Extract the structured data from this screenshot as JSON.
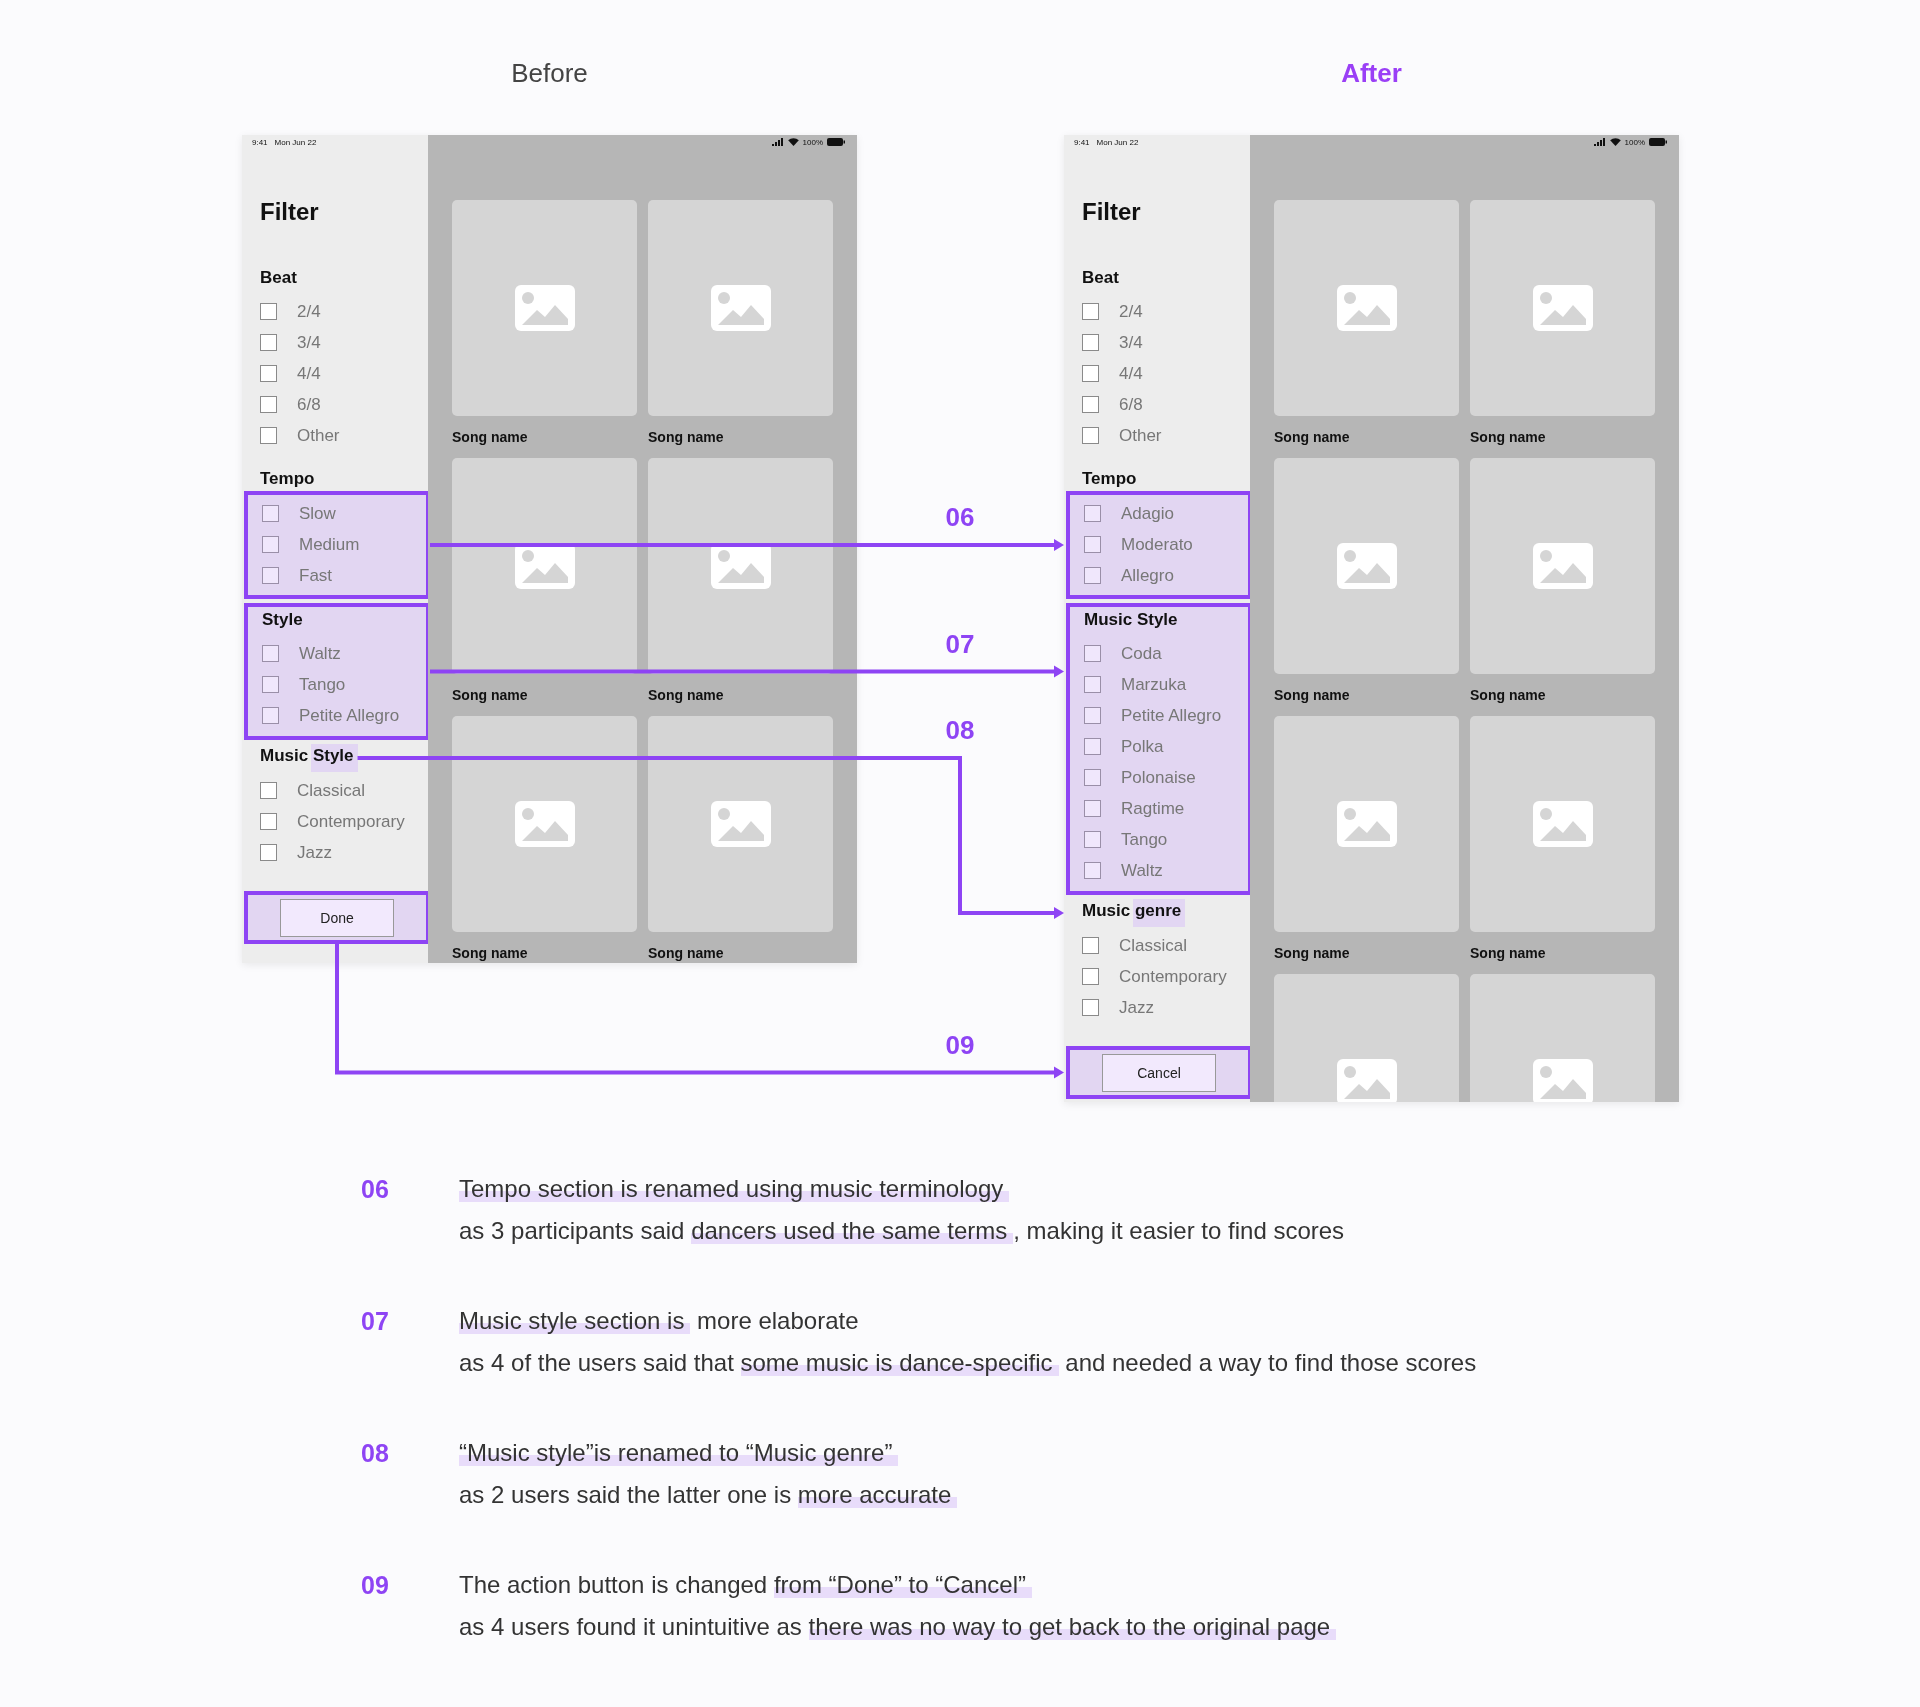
{
  "screens": [
    {
      "title": "Before",
      "emphasized": false,
      "status": {
        "time": "9:41",
        "date": "Mon Jun 22",
        "battery": "100%"
      },
      "filter_title": "Filter",
      "sections": [
        {
          "heading": [
            {
              "text": "Beat",
              "highlighted": false
            }
          ],
          "heading_boxed": false,
          "items_boxed": false,
          "options": [
            {
              "label": "2/4",
              "checked": false
            },
            {
              "label": "3/4",
              "checked": false
            },
            {
              "label": "4/4",
              "checked": false
            },
            {
              "label": "6/8",
              "checked": false
            },
            {
              "label": "Other",
              "checked": false
            }
          ]
        },
        {
          "heading": [
            {
              "text": "Tempo",
              "highlighted": false
            }
          ],
          "heading_boxed": false,
          "items_boxed": true,
          "options": [
            {
              "label": "Slow",
              "checked": false
            },
            {
              "label": "Medium",
              "checked": false
            },
            {
              "label": "Fast",
              "checked": false
            }
          ]
        },
        {
          "heading": [
            {
              "text": "Style",
              "highlighted": false
            }
          ],
          "heading_boxed": true,
          "items_boxed": true,
          "options": [
            {
              "label": "Waltz",
              "checked": false
            },
            {
              "label": "Tango",
              "checked": false
            },
            {
              "label": "Petite Allegro",
              "checked": false
            }
          ]
        },
        {
          "heading": [
            {
              "text": "Music ",
              "highlighted": false
            },
            {
              "text": "Style",
              "highlighted": true
            }
          ],
          "heading_boxed": false,
          "items_boxed": false,
          "options": [
            {
              "label": "Classical",
              "checked": false
            },
            {
              "label": "Contemporary",
              "checked": false
            },
            {
              "label": "Jazz",
              "checked": false
            }
          ]
        }
      ],
      "footer": {
        "button": "Done",
        "highlighted": true
      },
      "songs": [
        {
          "kind": "card",
          "name": "Song name"
        },
        {
          "kind": "card",
          "name": "Song name"
        },
        {
          "kind": "card",
          "name": "Song name"
        },
        {
          "kind": "card",
          "name": "Song name"
        },
        {
          "kind": "card",
          "name": "Song name"
        },
        {
          "kind": "card",
          "name": "Song name"
        }
      ]
    },
    {
      "title": "After",
      "emphasized": true,
      "status": {
        "time": "9:41",
        "date": "Mon Jun 22",
        "battery": "100%"
      },
      "filter_title": "Filter",
      "sections": [
        {
          "heading": [
            {
              "text": "Beat",
              "highlighted": false
            }
          ],
          "heading_boxed": false,
          "items_boxed": false,
          "options": [
            {
              "label": "2/4",
              "checked": false
            },
            {
              "label": "3/4",
              "checked": false
            },
            {
              "label": "4/4",
              "checked": false
            },
            {
              "label": "6/8",
              "checked": false
            },
            {
              "label": "Other",
              "checked": false
            }
          ]
        },
        {
          "heading": [
            {
              "text": "Tempo",
              "highlighted": false
            }
          ],
          "heading_boxed": false,
          "items_boxed": true,
          "options": [
            {
              "label": "Adagio",
              "checked": false
            },
            {
              "label": "Moderato",
              "checked": false
            },
            {
              "label": "Allegro",
              "checked": false
            }
          ]
        },
        {
          "heading": [
            {
              "text": "Music Style",
              "highlighted": false
            }
          ],
          "heading_boxed": true,
          "items_boxed": true,
          "options": [
            {
              "label": "Coda",
              "checked": false
            },
            {
              "label": "Marzuka",
              "checked": false
            },
            {
              "label": "Petite Allegro",
              "checked": false
            },
            {
              "label": "Polka",
              "checked": false
            },
            {
              "label": "Polonaise",
              "checked": false
            },
            {
              "label": "Ragtime",
              "checked": false
            },
            {
              "label": "Tango",
              "checked": false
            },
            {
              "label": "Waltz",
              "checked": false
            }
          ]
        },
        {
          "heading": [
            {
              "text": "Music ",
              "highlighted": false
            },
            {
              "text": "genre",
              "highlighted": true
            }
          ],
          "heading_boxed": false,
          "items_boxed": false,
          "options": [
            {
              "label": "Classical",
              "checked": false
            },
            {
              "label": "Contemporary",
              "checked": false
            },
            {
              "label": "Jazz",
              "checked": false
            }
          ]
        }
      ],
      "footer": {
        "button": "Cancel",
        "highlighted": true
      },
      "songs": [
        {
          "kind": "card",
          "name": "Song name"
        },
        {
          "kind": "card",
          "name": "Song name"
        },
        {
          "kind": "card",
          "name": "Song name"
        },
        {
          "kind": "card",
          "name": "Song name"
        },
        {
          "kind": "card",
          "name": "Song name"
        },
        {
          "kind": "card",
          "name": "Song name"
        },
        {
          "kind": "cut"
        },
        {
          "kind": "cut"
        }
      ]
    }
  ],
  "annotations": [
    {
      "number": "06",
      "kind": "straight"
    },
    {
      "number": "07",
      "kind": "straight"
    },
    {
      "number": "08",
      "kind": "elbow"
    },
    {
      "number": "09",
      "kind": "down"
    }
  ],
  "notes": [
    {
      "number": "06",
      "lines": [
        [
          {
            "text": "Tempo section is renamed using music terminology",
            "highlighted": true
          }
        ],
        [
          {
            "text": "as 3 participants said ",
            "highlighted": false
          },
          {
            "text": "dancers used the same terms",
            "highlighted": true
          },
          {
            "text": ", making it easier to find scores",
            "highlighted": false
          }
        ]
      ]
    },
    {
      "number": "07",
      "lines": [
        [
          {
            "text": "Music style section is",
            "highlighted": true
          },
          {
            "text": " more elaborate",
            "highlighted": false
          }
        ],
        [
          {
            "text": "as 4 of the users said that ",
            "highlighted": false
          },
          {
            "text": "some music is dance-specific",
            "highlighted": true
          },
          {
            "text": " and needed a way to find those scores",
            "highlighted": false
          }
        ]
      ]
    },
    {
      "number": "08",
      "lines": [
        [
          {
            "text": "“Music style”is renamed to “Music genre”",
            "highlighted": true
          }
        ],
        [
          {
            "text": "as 2 users said the latter one is ",
            "highlighted": false
          },
          {
            "text": "more accurate",
            "highlighted": true
          }
        ]
      ]
    },
    {
      "number": "09",
      "lines": [
        [
          {
            "text": "The action button is changed ",
            "highlighted": false
          },
          {
            "text": "from “Done” to “Cancel”",
            "highlighted": true
          }
        ],
        [
          {
            "text": "as 4 users found it unintuitive as ",
            "highlighted": false
          },
          {
            "text": "there was no way to get back to the original page",
            "highlighted": true
          }
        ]
      ]
    }
  ]
}
